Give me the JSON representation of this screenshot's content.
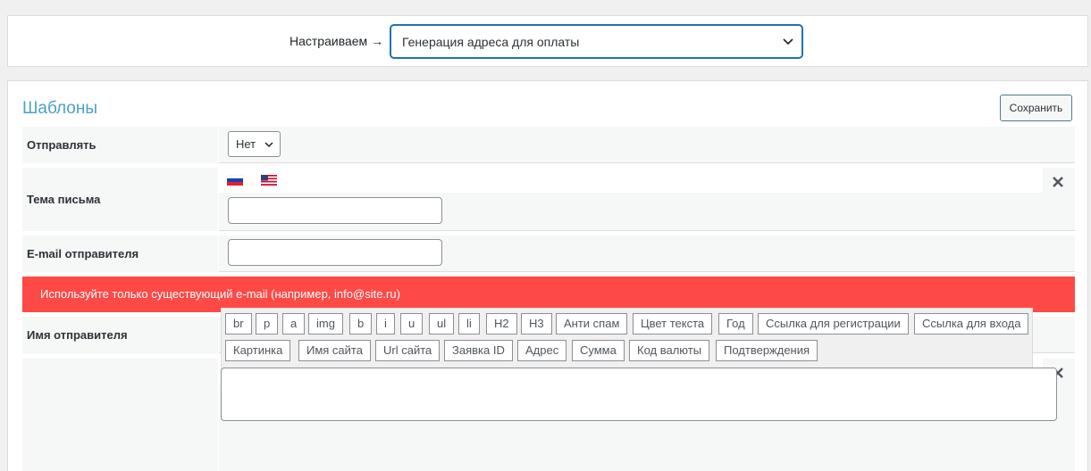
{
  "header": {
    "label": "Настраиваем →",
    "selected": "Генерация адреса для оплаты"
  },
  "panel": {
    "title": "Шаблоны",
    "save_label": "Сохранить"
  },
  "fields": {
    "send": {
      "label": "Отправлять",
      "value": "Нет"
    },
    "subject": {
      "label": "Тема письма"
    },
    "sender_email": {
      "label": "E-mail отправителя"
    },
    "sender_name": {
      "label": "Имя отправителя"
    }
  },
  "alert": "Используйте только существующий e-mail (например, info@site.ru)",
  "toolbar": {
    "row1": [
      "br",
      "p",
      "a",
      "img",
      "b",
      "i",
      "u",
      "ul",
      "li",
      "H2",
      "H3",
      "Анти спам",
      "Цвет текста",
      "Год",
      "Ссылка для регистрации",
      "Ссылка для входа"
    ],
    "row2": [
      "Картинка",
      "Имя сайта",
      "Url сайта",
      "Заявка ID",
      "Адрес",
      "Сумма",
      "Код валюты",
      "Подтверждения"
    ]
  },
  "colors": {
    "accent": "#2271b1",
    "title": "#4ba0c8",
    "alert": "#fd4a46"
  }
}
